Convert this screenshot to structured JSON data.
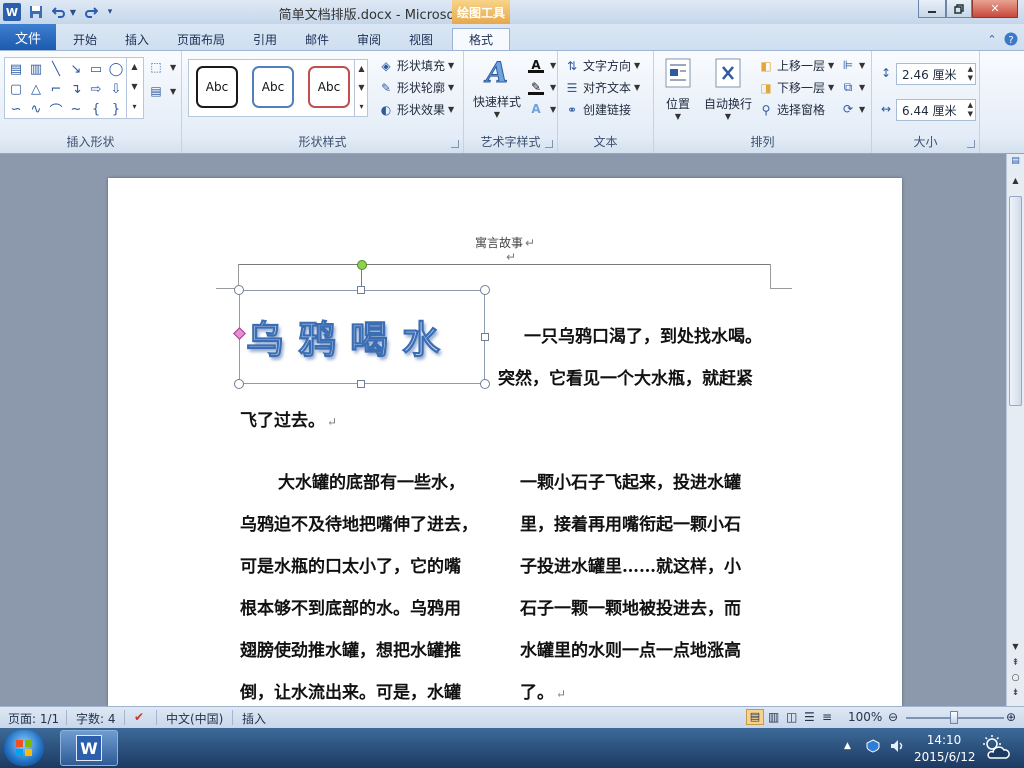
{
  "window": {
    "title": "简单文档排版.docx - Microsoft Word",
    "drawing_tools_tab": "绘图工具"
  },
  "quick_access": {
    "word_logo": "W",
    "save_icon": "save-icon",
    "undo_icon": "undo-icon",
    "redo_icon": "redo-icon"
  },
  "tabs": {
    "file": "文件",
    "home": "开始",
    "insert": "插入",
    "page_layout": "页面布局",
    "references": "引用",
    "mailings": "邮件",
    "review": "审阅",
    "view": "视图",
    "format": "格式"
  },
  "ribbon": {
    "insert_shapes": {
      "label": "插入形状"
    },
    "shape_styles": {
      "label": "形状样式",
      "presets": [
        "Abc",
        "Abc",
        "Abc"
      ],
      "preset_colors": [
        "#1a1a1a",
        "#4f81bd",
        "#c0504d"
      ],
      "fill": "形状填充",
      "outline": "形状轮廓",
      "effects": "形状效果"
    },
    "wordart": {
      "label": "艺术字样式",
      "quick_styles": "快速样式"
    },
    "text": {
      "label": "文本",
      "direction": "文字方向",
      "align": "对齐文本",
      "link": "创建链接"
    },
    "arrange": {
      "label": "排列",
      "position": "位置",
      "wrap": "自动换行",
      "bring_forward": "上移一层",
      "send_backward": "下移一层",
      "selection_pane": "选择窗格"
    },
    "size": {
      "label": "大小",
      "height": "2.46 厘米",
      "width": "6.44 厘米"
    }
  },
  "document": {
    "header": "寓言故事",
    "wordart_title": "乌鸦喝水",
    "para1_line1": "一只乌鸦口渴了，到处找水喝。",
    "para1_line2": "突然，它看见一个大水瓶，就赶紧",
    "para1_line3": "飞了过去。",
    "left_column": [
      "大水罐的底部有一些水，",
      "乌鸦迫不及待地把嘴伸了进去，",
      "可是水瓶的口太小了，它的嘴",
      "根本够不到底部的水。乌鸦用",
      "翅膀使劲推水罐，想把水罐推",
      "倒，让水流出来。可是，水罐"
    ],
    "right_column": [
      "一颗小石子飞起来，投进水罐",
      "里，接着再用嘴衔起一颗小石",
      "子投进水罐里……就这样，小",
      "石子一颗一颗地被投进去，而",
      "水罐里的水则一点一点地涨高",
      "了。"
    ]
  },
  "status": {
    "page": "页面: 1/1",
    "words": "字数: 4",
    "language": "中文(中国)",
    "mode": "插入",
    "zoom": "100%"
  },
  "taskbar": {
    "time": "14:10",
    "date": "2015/6/12"
  }
}
